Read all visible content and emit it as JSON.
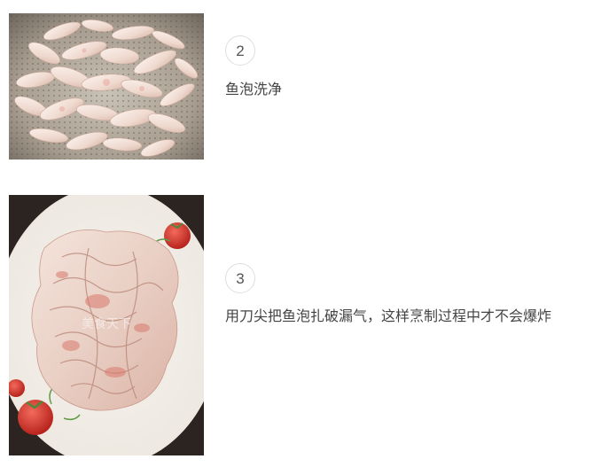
{
  "steps": [
    {
      "number": "2",
      "description": "鱼泡洗净",
      "image": "fish-maw-in-colander"
    },
    {
      "number": "3",
      "description": "用刀尖把鱼泡扎破漏气，这样烹制过程中才不会爆炸",
      "image": "punctured-fish-maw-on-plate",
      "watermark": "美食天下"
    }
  ]
}
